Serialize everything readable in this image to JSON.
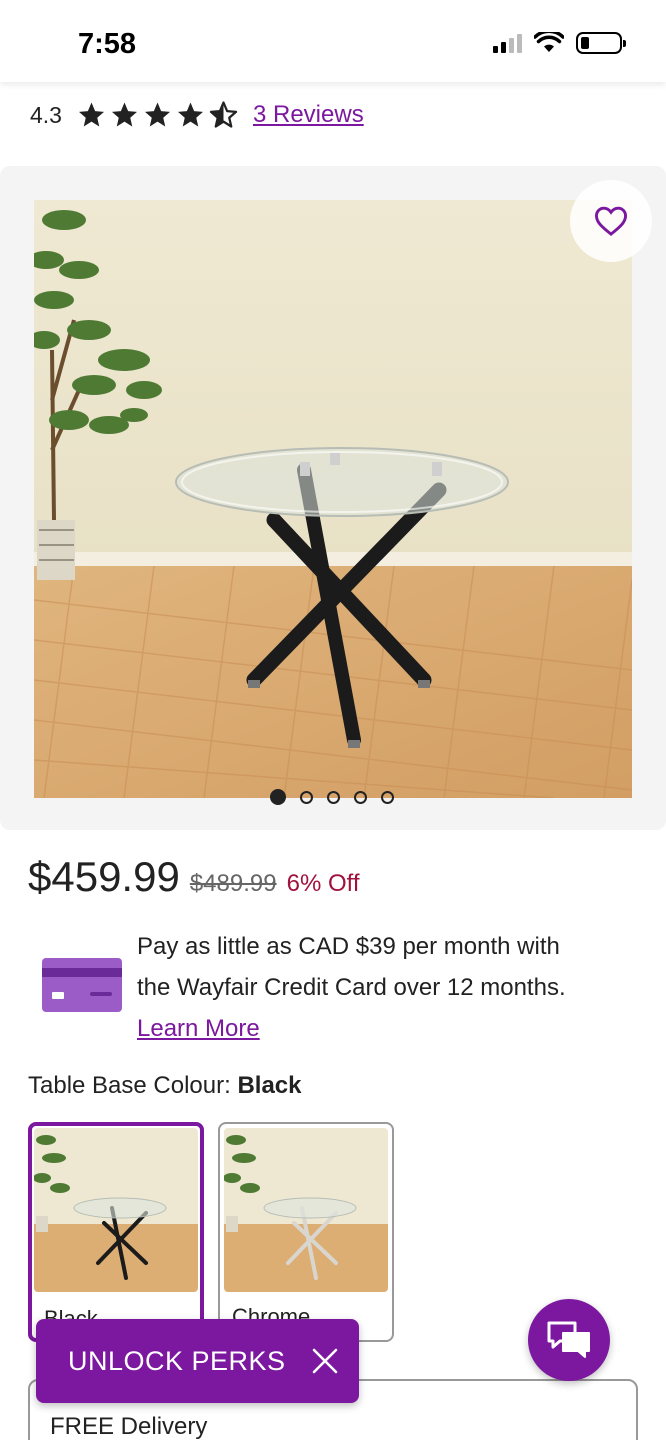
{
  "status_bar": {
    "time": "7:58"
  },
  "rating": {
    "score": "4.3",
    "stars": 4.5,
    "reviews_label": "3 Reviews"
  },
  "gallery": {
    "image_count": 5,
    "active_index": 0
  },
  "pricing": {
    "price": "$459.99",
    "original_price": "$489.99",
    "discount": "6% Off"
  },
  "credit": {
    "line1": "Pay as little as CAD $39 per month with",
    "line2": "the Wayfair Credit Card over 12 months.",
    "learn_more": "Learn More"
  },
  "options": {
    "label": "Table Base Colour:",
    "selected": "Black",
    "swatches": [
      {
        "name": "Black",
        "selected": true
      },
      {
        "name": "Chrome",
        "selected": false
      }
    ]
  },
  "delivery": {
    "text": "FREE Delivery"
  },
  "perks_banner": {
    "label": "UNLOCK PERKS"
  },
  "colors": {
    "accent": "#7b189f",
    "discount": "#a0123e"
  }
}
